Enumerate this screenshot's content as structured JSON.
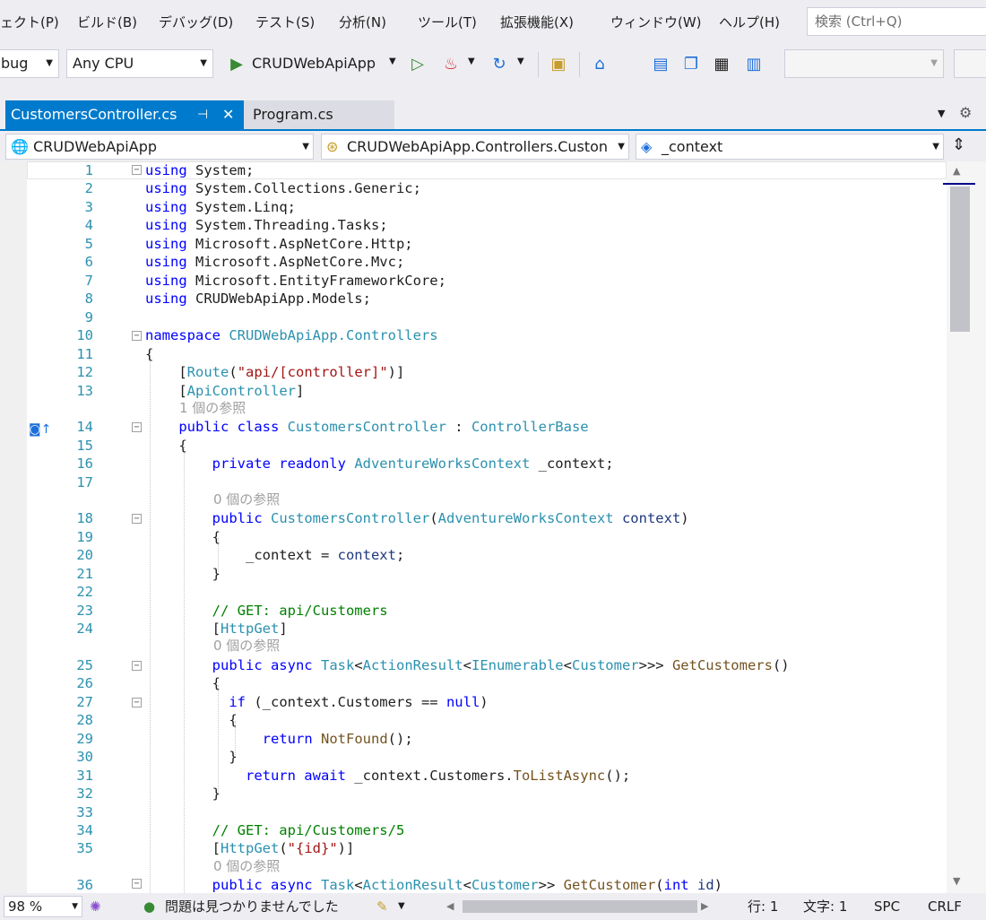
{
  "menu": [
    "ェクト(P)",
    "ビルド(B)",
    "デバッグ(D)",
    "テスト(S)",
    "分析(N)",
    "ツール(T)",
    "拡張機能(X)",
    "ウィンドウ(W)",
    "ヘルプ(H)"
  ],
  "search_placeholder": "検索 (Ctrl+Q)",
  "toolbar": {
    "config": "bug",
    "platform": "Any CPU",
    "startup": "CRUDWebApiApp"
  },
  "tabs": {
    "active": "CustomersController.cs",
    "inactive": "Program.cs"
  },
  "nav": {
    "project": "CRUDWebApiApp",
    "type": "CRUDWebApiApp.Controllers.Custon",
    "member": "_context"
  },
  "codelens": {
    "ref1": "1 個の参照",
    "ref0": "0 個の参照"
  },
  "status": {
    "zoom": "98 %",
    "issues": "問題は見つかりませんでした",
    "line": "行: 1",
    "col": "文字: 1",
    "ws": "SPC",
    "eol": "CRLF"
  },
  "colors": {
    "accent": "#007acc",
    "keyword": "#0000ff",
    "type": "#2b91af",
    "comment": "#008000",
    "string": "#a31515"
  }
}
